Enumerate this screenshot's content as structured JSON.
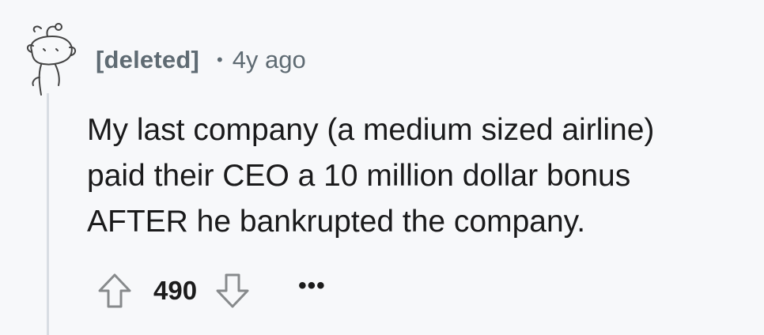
{
  "comment": {
    "author": "[deleted]",
    "separator": "•",
    "time": "4y ago",
    "body_lines": [
      "My last company (a medium sized airline)",
      "paid their CEO a 10 million dollar bonus",
      "AFTER he bankrupted the company."
    ],
    "score": "490",
    "more_label": "•••"
  },
  "icons": {
    "avatar": "deleted-user-snoo-icon",
    "upvote": "upvote-arrow-icon",
    "downvote": "downvote-arrow-icon",
    "more": "more-options-icon"
  },
  "colors": {
    "background": "#f7f8fa",
    "meta_text": "#5f6b73",
    "body_text": "#1a1a1b",
    "thread_line": "#d8dde3",
    "icon_stroke": "#878a8c"
  }
}
